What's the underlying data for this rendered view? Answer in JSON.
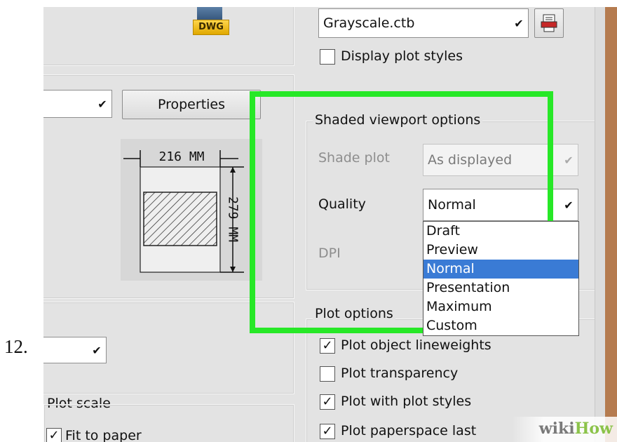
{
  "step_label": "12.",
  "dwg_badge": "DWG",
  "plot_style_table": {
    "selected": "Grayscale.ctb"
  },
  "display_plot_styles": {
    "label": "Display plot styles",
    "checked": false
  },
  "printer": {
    "properties_label": "Properties"
  },
  "paper_preview": {
    "width_label": "216 MM",
    "height_label": "279 MM"
  },
  "shaded_viewport": {
    "title": "Shaded viewport options",
    "shade_plot_label": "Shade plot",
    "shade_plot_value": "As displayed",
    "quality_label": "Quality",
    "quality_value": "Normal",
    "dpi_label": "DPI",
    "quality_options": [
      "Draft",
      "Preview",
      "Normal",
      "Presentation",
      "Maximum",
      "Custom"
    ],
    "quality_selected_index": 2
  },
  "plot_options": {
    "title": "Plot options",
    "items": [
      {
        "label": "Plot object lineweights",
        "checked": true
      },
      {
        "label": "Plot transparency",
        "checked": false
      },
      {
        "label": "Plot with plot styles",
        "checked": true
      },
      {
        "label": "Plot paperspace last",
        "checked": true
      }
    ]
  },
  "plot_scale": {
    "title": "Plot scale",
    "fit_to_paper_label": "Fit to paper",
    "fit_to_paper_checked": true
  },
  "watermark": {
    "wiki": "wiki",
    "how": "How"
  },
  "colors": {
    "highlight": "#27e827",
    "selection": "#3a7bd5",
    "watermark_wiki": "#7a7a7a",
    "watermark_how": "#8bc34a"
  }
}
